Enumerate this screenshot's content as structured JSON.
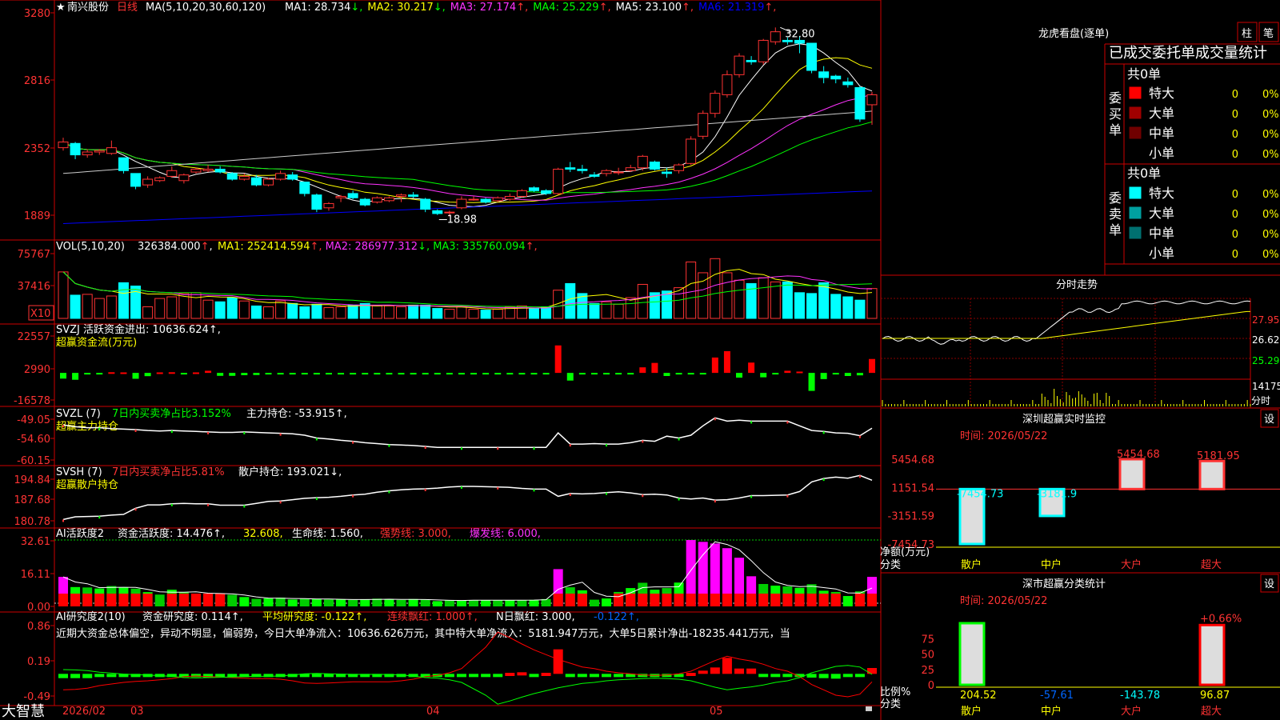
{
  "header": {
    "star": "★",
    "stock_name": "南兴股份",
    "period": "日线",
    "ma_params": "MA(5,10,20,30,60,120)",
    "ma_values": [
      {
        "label": "MA1:",
        "value": "28.734",
        "dir": "↓",
        "color": "#ffffff"
      },
      {
        "label": "MA2:",
        "value": "30.217",
        "dir": "↓",
        "color": "#ffff00"
      },
      {
        "label": "MA3:",
        "value": "27.174",
        "dir": "↑",
        "color": "#ff33ff"
      },
      {
        "label": "MA4:",
        "value": "25.229",
        "dir": "↑",
        "color": "#00ff00"
      },
      {
        "label": "MA5:",
        "value": "23.100",
        "dir": "↑",
        "color": "#ffffff"
      },
      {
        "label": "MA6:",
        "value": "21.319",
        "dir": "↑",
        "color": "#0000ff"
      }
    ]
  },
  "price_panel": {
    "y_ticks": [
      "3280",
      "2816",
      "2352",
      "1889"
    ],
    "high_label": "32.80",
    "low_label": "18.98"
  },
  "vol_panel": {
    "title": "VOL(5,10,20)",
    "value": "326384.000",
    "ma_values": [
      {
        "label": "MA1:",
        "value": "252414.594",
        "dir": "↑",
        "color": "#ffff00"
      },
      {
        "label": "MA2:",
        "value": "286977.312",
        "dir": "↓",
        "color": "#ff33ff"
      },
      {
        "label": "MA3:",
        "value": "335760.094",
        "dir": "↑",
        "color": "#00ff00"
      }
    ],
    "y_ticks": [
      "75767",
      "37416"
    ],
    "unit": "X10"
  },
  "svzj_panel": {
    "line1": "SVZJ  活跃资金进出: 10636.624↑,",
    "line2": "超赢资金流(万元)",
    "y_ticks": [
      "22557",
      "2990",
      "-16578"
    ]
  },
  "svzl_panel": {
    "title": "SVZL (7)",
    "ratio": "7日内买卖净占比3.152%",
    "holding": "主力持仓: -53.915↑,",
    "line2": "超赢主力持仓",
    "y_ticks": [
      "-49.05",
      "-54.60",
      "-60.15"
    ]
  },
  "svsh_panel": {
    "title": "SVSH (7)",
    "ratio": "7日内买卖净占比5.81%",
    "holding": "散户持仓: 193.021↓,",
    "line2": "超赢散户持仓",
    "y_ticks": [
      "194.84",
      "187.68",
      "180.78"
    ]
  },
  "ai_active_panel": {
    "title": "AI活跃度2",
    "a": "资金活跃度: 14.476↑,",
    "b": "32.608,",
    "c": "生命线: 1.560,",
    "d": "强势线: 3.000,",
    "e": "爆发线: 6.000,",
    "y_ticks": [
      "32.61",
      "16.11",
      "0.00"
    ]
  },
  "ai_research_panel": {
    "title": "AI研究度2(10)",
    "a": "资金研究度: 0.114↑,",
    "b": "平均研究度: -0.122↑,",
    "c": "连续飘红: 1.000↑,",
    "d": "N日飘红: 3.000,",
    "e": "-0.122↑,",
    "commentary": "近期大资金总体偏空，异动不明显，偏弱势，今日大单净流入：10636.626万元，其中特大单净流入：5181.947万元，大单5日累计净出-18235.441万元，当",
    "y_ticks": [
      "0.86",
      "0.19",
      "-0.49"
    ]
  },
  "bottom_bar": {
    "brand": "大智慧",
    "dates": [
      "2026/02",
      "03",
      "04",
      "05"
    ]
  },
  "chart_data": {
    "type": "candlestick",
    "title": "南兴股份 日线",
    "candles": [
      [
        24.4,
        25.1,
        24.2,
        24.8
      ],
      [
        24.7,
        24.8,
        23.6,
        23.9
      ],
      [
        23.9,
        24.3,
        23.7,
        24.1
      ],
      [
        24.1,
        24.3,
        23.9,
        24.2
      ],
      [
        24.0,
        24.9,
        23.9,
        24.4
      ],
      [
        23.7,
        23.7,
        22.6,
        22.8
      ],
      [
        22.6,
        22.6,
        21.5,
        21.7
      ],
      [
        21.8,
        22.4,
        21.6,
        22.2
      ],
      [
        22.1,
        22.4,
        22.0,
        22.3
      ],
      [
        22.4,
        23.1,
        22.3,
        22.8
      ],
      [
        22.1,
        22.6,
        21.9,
        22.5
      ],
      [
        22.7,
        23.0,
        22.6,
        22.9
      ],
      [
        22.8,
        23.2,
        22.7,
        22.9
      ],
      [
        22.9,
        23.1,
        22.6,
        22.7
      ],
      [
        22.6,
        22.7,
        22.1,
        22.2
      ],
      [
        22.2,
        22.6,
        22.1,
        22.4
      ],
      [
        22.3,
        22.5,
        21.7,
        21.8
      ],
      [
        21.8,
        22.3,
        21.7,
        22.2
      ],
      [
        22.2,
        22.8,
        22.1,
        22.6
      ],
      [
        22.5,
        22.7,
        22.1,
        22.2
      ],
      [
        22.0,
        22.0,
        21.0,
        21.2
      ],
      [
        21.1,
        21.2,
        19.9,
        20.1
      ],
      [
        20.2,
        20.6,
        20.0,
        20.5
      ],
      [
        20.9,
        21.1,
        20.6,
        21.0
      ],
      [
        21.2,
        21.4,
        20.8,
        20.9
      ],
      [
        20.8,
        20.9,
        20.3,
        20.4
      ],
      [
        20.6,
        21.0,
        20.5,
        20.9
      ],
      [
        20.7,
        21.0,
        20.6,
        20.9
      ],
      [
        21.0,
        21.2,
        20.6,
        21.1
      ],
      [
        21.1,
        21.3,
        20.9,
        21.0
      ],
      [
        20.8,
        20.9,
        19.9,
        20.1
      ],
      [
        20.0,
        20.1,
        19.7,
        19.8
      ],
      [
        19.9,
        20.0,
        19.6,
        19.9
      ],
      [
        20.2,
        21.0,
        20.1,
        20.8
      ],
      [
        20.8,
        21.0,
        20.7,
        20.8
      ],
      [
        20.8,
        20.9,
        20.5,
        20.6
      ],
      [
        20.7,
        21.0,
        20.6,
        20.9
      ],
      [
        20.8,
        21.2,
        20.7,
        21.0
      ],
      [
        21.0,
        21.5,
        20.9,
        21.4
      ],
      [
        21.6,
        21.7,
        21.3,
        21.4
      ],
      [
        21.4,
        21.5,
        21.1,
        21.2
      ],
      [
        21.2,
        23.0,
        21.1,
        22.9
      ],
      [
        23.0,
        23.4,
        22.7,
        22.9
      ],
      [
        22.9,
        23.2,
        22.6,
        22.8
      ],
      [
        22.5,
        22.7,
        22.3,
        22.4
      ],
      [
        22.6,
        22.9,
        22.4,
        22.8
      ],
      [
        22.7,
        23.0,
        22.5,
        22.7
      ],
      [
        22.8,
        23.2,
        22.7,
        23.0
      ],
      [
        23.0,
        23.9,
        22.8,
        23.8
      ],
      [
        23.4,
        23.5,
        22.8,
        22.9
      ],
      [
        22.7,
        23.0,
        22.3,
        22.6
      ],
      [
        22.8,
        23.3,
        22.6,
        23.2
      ],
      [
        23.3,
        25.2,
        23.2,
        25.0
      ],
      [
        25.2,
        27.0,
        25.0,
        26.8
      ],
      [
        26.8,
        28.4,
        26.5,
        28.2
      ],
      [
        28.1,
        29.8,
        27.9,
        29.5
      ],
      [
        29.5,
        31.0,
        29.3,
        30.8
      ],
      [
        30.5,
        30.8,
        30.2,
        30.4
      ],
      [
        30.4,
        32.0,
        30.2,
        31.9
      ],
      [
        31.8,
        32.8,
        31.6,
        32.5
      ],
      [
        31.9,
        32.1,
        31.6,
        31.8
      ],
      [
        31.9,
        32.2,
        31.0,
        31.7
      ],
      [
        31.7,
        31.7,
        29.6,
        29.8
      ],
      [
        29.7,
        30.1,
        28.9,
        29.3
      ],
      [
        29.4,
        29.5,
        28.9,
        29.2
      ],
      [
        29.0,
        29.3,
        28.6,
        28.8
      ],
      [
        28.6,
        28.7,
        26.2,
        26.4
      ],
      [
        27.4,
        28.3,
        26.0,
        28.1
      ]
    ],
    "price_range": [
      18.4,
      33.6
    ],
    "volume_x10": [
      56000,
      28000,
      29000,
      24000,
      27000,
      43000,
      39000,
      14000,
      24000,
      26000,
      30000,
      31000,
      22000,
      20000,
      25000,
      21000,
      15000,
      14000,
      21000,
      18000,
      14000,
      17000,
      13000,
      14000,
      16000,
      18000,
      15000,
      15000,
      14000,
      16000,
      16000,
      12000,
      11000,
      14000,
      11000,
      10000,
      11000,
      14000,
      15000,
      12000,
      14000,
      34000,
      42000,
      30000,
      18000,
      20000,
      17000,
      25000,
      41000,
      31000,
      33000,
      37000,
      68000,
      55000,
      72000,
      55000,
      46000,
      42000,
      49000,
      44000,
      44000,
      31000,
      30000,
      43000,
      29000,
      26000,
      22000,
      36000
    ],
    "volume_range": [
      0,
      80000
    ],
    "svzj": [
      -3500,
      -4200,
      -800,
      -500,
      400,
      300,
      -3600,
      -2000,
      300,
      400,
      -300,
      300,
      1300,
      -1800,
      -1800,
      -1400,
      -1300,
      -800,
      -800,
      -800,
      -600,
      -600,
      -600,
      -500,
      -600,
      -500,
      -500,
      -400,
      -400,
      -300,
      -300,
      -200,
      -200,
      -200,
      -200,
      -200,
      -200,
      -200,
      -300,
      -300,
      -200,
      16800,
      -4700,
      -400,
      -300,
      -300,
      -300,
      -200,
      3400,
      6100,
      -1900,
      -200,
      -200,
      -200,
      9400,
      13300,
      -2900,
      6300,
      -2700,
      -200,
      1300,
      800,
      -11000,
      -3800,
      -500,
      -1900,
      -1500,
      8500
    ],
    "svzj_range": [
      -16578,
      22557
    ],
    "svzl": [
      -51.8,
      -52.2,
      -52.4,
      -52.4,
      -52.6,
      -52.7,
      -52.8,
      -53.0,
      -53.1,
      -53.0,
      -53.1,
      -53.2,
      -53.3,
      -53.4,
      -53.4,
      -53.3,
      -53.4,
      -53.5,
      -53.6,
      -53.7,
      -54.0,
      -54.6,
      -54.8,
      -55.1,
      -55.3,
      -55.6,
      -55.8,
      -56.0,
      -56.1,
      -56.2,
      -56.4,
      -56.6,
      -56.6,
      -56.6,
      -56.6,
      -56.6,
      -56.6,
      -56.6,
      -56.6,
      -56.6,
      -56.6,
      -53.5,
      -55.9,
      -55.9,
      -55.8,
      -55.9,
      -55.9,
      -55.6,
      -55.1,
      -55.3,
      -54.2,
      -54.6,
      -54.0,
      -52.0,
      -50.3,
      -51.0,
      -50.8,
      -51.0,
      -51.0,
      -51.0,
      -51.0,
      -52.0,
      -53.0,
      -53.2,
      -53.5,
      -53.6,
      -54.1,
      -52.5
    ],
    "svzl_range": [
      -60.15,
      -49.05
    ],
    "svsh": [
      181.5,
      182.3,
      182.4,
      182.5,
      182.8,
      183.0,
      184.8,
      185.8,
      185.8,
      186.1,
      186.2,
      186.1,
      186.1,
      185.7,
      185.7,
      185.7,
      186.2,
      186.8,
      186.9,
      187.3,
      187.7,
      187.9,
      188.0,
      188.3,
      188.7,
      188.9,
      189.5,
      189.9,
      190.2,
      190.4,
      190.5,
      190.7,
      191.0,
      191.2,
      191.2,
      191.1,
      191.0,
      190.9,
      190.6,
      190.4,
      190.4,
      188.3,
      189.1,
      189.0,
      189.1,
      189.4,
      189.6,
      189.3,
      188.8,
      188.9,
      188.7,
      187.8,
      187.5,
      187.8,
      187.2,
      187.3,
      187.8,
      188.5,
      188.5,
      188.6,
      188.7,
      189.7,
      192.5,
      193.5,
      193.9,
      193.6,
      194.4,
      193.0
    ],
    "svsh_range": [
      180.2,
      195.4
    ],
    "ai_active": [
      14.5,
      9.5,
      9.3,
      8.8,
      10.0,
      9.4,
      8.7,
      7.0,
      5.8,
      8.2,
      6.9,
      6.3,
      6.3,
      6.4,
      5.7,
      4.6,
      3.7,
      4.0,
      4.3,
      3.4,
      3.9,
      3.6,
      3.4,
      3.5,
      3.2,
      3.4,
      3.8,
      3.4,
      3.2,
      3.6,
      3.3,
      2.6,
      3.1,
      3.0,
      3.1,
      3.0,
      3.1,
      3.0,
      3.1,
      3.2,
      3.6,
      18.3,
      9.4,
      7.9,
      3.3,
      3.9,
      7.1,
      9.0,
      11.6,
      8.2,
      9.0,
      11.7,
      32.6,
      31.7,
      30.9,
      28.6,
      23.9,
      14.8,
      11.0,
      10.2,
      9.8,
      9.1,
      10.9,
      7.7,
      7.1,
      5.1,
      7.4,
      14.5
    ],
    "ai_active_range": [
      0,
      32.61
    ],
    "ai_research": [
      -0.08,
      -0.08,
      -0.08,
      -0.06,
      -0.05,
      -0.05,
      -0.05,
      -0.03,
      -0.02,
      -0.02,
      -0.04,
      -0.05,
      -0.07,
      -0.07,
      -0.06,
      -0.05,
      -0.05,
      -0.05,
      -0.04,
      -0.05,
      -0.05,
      -0.05,
      -0.05,
      -0.05,
      -0.05,
      -0.05,
      -0.05,
      -0.05,
      -0.05,
      -0.05,
      -0.05,
      -0.05,
      -0.05,
      -0.05,
      -0.05,
      -0.04,
      -0.03,
      0.02,
      0.03,
      -0.03,
      0.02,
      0.46,
      -0.03,
      -0.03,
      -0.03,
      -0.03,
      -0.03,
      -0.03,
      -0.03,
      -0.02,
      -0.02,
      -0.02,
      0.02,
      0.06,
      0.12,
      0.3,
      0.1,
      0.1,
      -0.03,
      -0.03,
      -0.04,
      -0.04,
      -0.07,
      -0.08,
      -0.09,
      -0.04,
      -0.03,
      0.11
    ],
    "ai_research_avg": [
      -0.3,
      -0.29,
      -0.27,
      -0.22,
      -0.19,
      -0.16,
      -0.14,
      -0.13,
      -0.11,
      -0.09,
      -0.05,
      -0.04,
      -0.05,
      -0.06,
      -0.07,
      -0.08,
      -0.09,
      -0.09,
      -0.1,
      -0.13,
      -0.17,
      -0.18,
      -0.17,
      -0.16,
      -0.15,
      -0.15,
      -0.15,
      -0.15,
      -0.13,
      -0.1,
      -0.05,
      -0.03,
      0.02,
      0.1,
      0.3,
      0.5,
      0.78,
      0.68,
      0.56,
      0.45,
      0.36,
      0.27,
      0.2,
      0.13,
      0.1,
      0.05,
      0.02,
      0.0,
      -0.02,
      -0.03,
      -0.02,
      0.0,
      0.05,
      0.15,
      0.25,
      0.33,
      0.28,
      0.24,
      0.18,
      0.1,
      0.05,
      -0.05,
      -0.2,
      -0.3,
      -0.4,
      -0.43,
      -0.38,
      -0.15
    ],
    "ai_research_range": [
      -0.49,
      0.86
    ]
  },
  "right_panel": {
    "lhb_title": "龙虎看盘(逐单)",
    "tab_bar": "柱",
    "tab_pen": "笔",
    "table_title": "已成交委托单成交量统计",
    "buy_label": "委买单",
    "sell_label": "委卖单",
    "buy_count": "共0单",
    "sell_count": "共0单",
    "buy_rows": [
      {
        "name": "特大",
        "value": "0",
        "pct": "0%",
        "color": "#ff0000"
      },
      {
        "name": "大单",
        "value": "0",
        "pct": "0%",
        "color": "#a00000"
      },
      {
        "name": "中单",
        "value": "0",
        "pct": "0%",
        "color": "#700000"
      },
      {
        "name": "小单",
        "value": "0",
        "pct": "0%",
        "color": "#000000"
      }
    ],
    "sell_rows": [
      {
        "name": "特大",
        "value": "0",
        "pct": "0%",
        "color": "#00ffff"
      },
      {
        "name": "大单",
        "value": "0",
        "pct": "0%",
        "color": "#00a0a0"
      },
      {
        "name": "中单",
        "value": "0",
        "pct": "0%",
        "color": "#007070"
      },
      {
        "name": "小单",
        "value": "0",
        "pct": "0%",
        "color": "#000000"
      }
    ],
    "intraday_title": "分时走势",
    "intraday_ticks": [
      "27.95",
      "26.62",
      "25.29",
      "14175"
    ],
    "intraday_time_label": "分时",
    "monitor_title": "深圳超赢实时监控",
    "monitor_set": "设",
    "monitor_time": "时间: 2026/05/22",
    "monitor_ticks": [
      "5454.68",
      "1151.54",
      "-3151.59",
      "-7454.73"
    ],
    "monitor_ylabel": "净额(万元)",
    "monitor_xlabel": "分类",
    "categories": [
      "散户",
      "中户",
      "大户",
      "超大"
    ],
    "monitor_values": [
      -7454.73,
      -3181.9,
      5454.68,
      5181.95
    ],
    "monitor_labels": [
      "-7454.73",
      "-3181.9",
      "5454.68",
      "5181.95"
    ],
    "stat_title": "深市超赢分类统计",
    "stat_set": "设",
    "stat_time": "时间: 2026/05/22",
    "stat_ticks": [
      "75",
      "50",
      "25",
      "0"
    ],
    "stat_ylabel": "比例%",
    "stat_xlabel": "分类",
    "stat_values": [
      "204.52",
      "-57.61",
      "-143.78",
      "96.87"
    ],
    "stat_top_label": "+0.66%"
  }
}
